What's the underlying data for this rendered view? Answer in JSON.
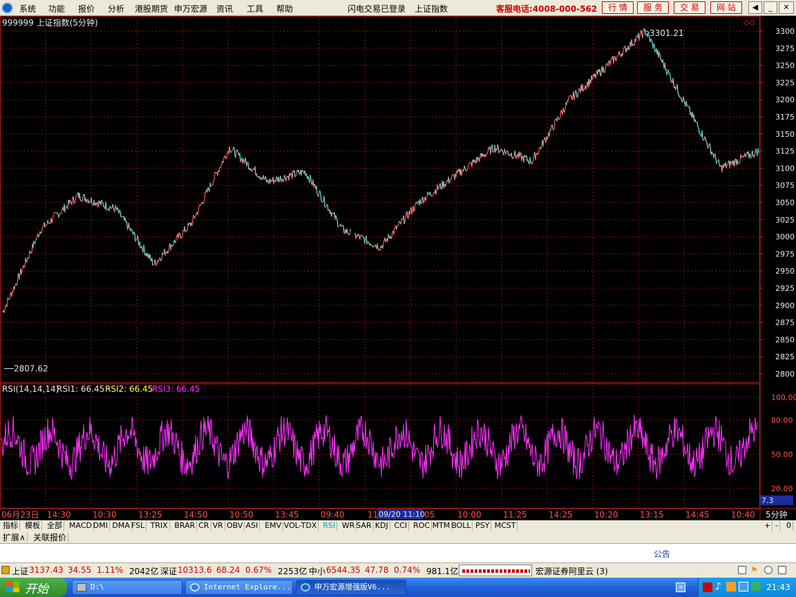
{
  "menu": {
    "items": [
      "系统",
      "功能",
      "报价",
      "分析",
      "港股期货",
      "申万宏源",
      "资讯",
      "工具",
      "帮助"
    ],
    "login_status": "闪电交易已登录",
    "index_name": "上证指数",
    "phone": "客服电话:4008-000-562",
    "trade_buttons": [
      "行 情",
      "服 务",
      "交 易",
      "网 站"
    ]
  },
  "chart": {
    "title": "999999 上证指数(5分钟)",
    "high_label": "3301.21",
    "low_label": "2807.62",
    "price_ticks": [
      "3300",
      "3275",
      "3250",
      "3225",
      "3200",
      "3175",
      "3150",
      "3125",
      "3100",
      "3075",
      "3050",
      "3025",
      "3000",
      "2975",
      "2950",
      "2925",
      "2900",
      "2875",
      "2850",
      "2825",
      "2800"
    ],
    "rsi_title": "RSI(14,14,14)",
    "rsi1_label": "RSI1: 66.45",
    "rsi2_label": "RSI2: 66.45",
    "rsi3_label": "RSI3: 66.45",
    "rsi_ticks": [
      "100.00",
      "80.00",
      "50.00",
      "20.00"
    ],
    "rsi_cursor": "7.3",
    "time_labels": [
      "06月23日",
      "14:30",
      "10:30",
      "13:25",
      "14:50",
      "10:50",
      "13:45",
      "09:40",
      "11:1",
      "05",
      "10:00",
      "11:25",
      "14:25",
      "10:20",
      "13:15",
      "14:45",
      "10:40"
    ],
    "cursor_time": "09/20 11:10",
    "period": "5分钟",
    "colors": {
      "price_up": "#ff5050",
      "price_down": "#5ff0f0",
      "rsi": "#ff33ff",
      "grid": "#8b1010",
      "axis": "#b22222",
      "text_white": "#e8e8e8",
      "rsi2": "#ffff55"
    }
  },
  "chart_data": {
    "type": "line",
    "title": "999999 上证指数(5分钟)",
    "ylim": [
      2800,
      3300
    ],
    "x": [
      "06月23日",
      "14:30",
      "10:30",
      "13:25",
      "14:50",
      "10:50",
      "13:45",
      "09:40",
      "11:10",
      "10:00",
      "11:25",
      "14:25",
      "10:20",
      "13:15",
      "14:45",
      "10:40"
    ],
    "series": [
      {
        "name": "上证指数",
        "values": [
          2890,
          3010,
          3060,
          3040,
          2960,
          3020,
          3130,
          3080,
          3095,
          3010,
          2985,
          3050,
          3090,
          3130,
          3110,
          3200,
          3250,
          3300,
          3200,
          3100,
          3125
        ]
      },
      {
        "name": "RSI1",
        "values": [
          66.45
        ]
      }
    ]
  },
  "toolbar": {
    "tabs": [
      "指标",
      "模板",
      "全部",
      "MACD",
      "DMI",
      "DMA",
      "FSL",
      "TRIX",
      "BRAR",
      "CR",
      "VR",
      "OBV",
      "ASI",
      "EMV",
      "VOL-TDX",
      "RSI",
      "WR",
      "SAR",
      "KDJ",
      "CCI",
      "ROC",
      "MTM",
      "BOLL",
      "PSY",
      "MCST"
    ],
    "tabs2": [
      "扩展∧",
      "关联报价"
    ],
    "right": [
      "+",
      "-",
      "0"
    ]
  },
  "notice": "公告",
  "status": {
    "sh_label": "上证",
    "sh_value": "3137.43",
    "sh_chg": "34.55",
    "sh_pct": "1.11%",
    "sh_vol": "2042亿",
    "sz_label": "深证",
    "sz_value": "10313.6",
    "sz_chg": "68.24",
    "sz_pct": "0.67%",
    "sz_vol": "2253亿",
    "zx_label": "中小",
    "zx_value": "6544.35",
    "zx_chg": "47.78",
    "zx_pct": "0.74%",
    "zx_vol": "981.1亿",
    "broker": "宏源证券阿里云 (3)"
  },
  "taskbar": {
    "start": "开始",
    "tasks": [
      "D:\\",
      "Internet Explore...",
      "申万宏源增强版V6..."
    ],
    "clock": "21:43"
  }
}
